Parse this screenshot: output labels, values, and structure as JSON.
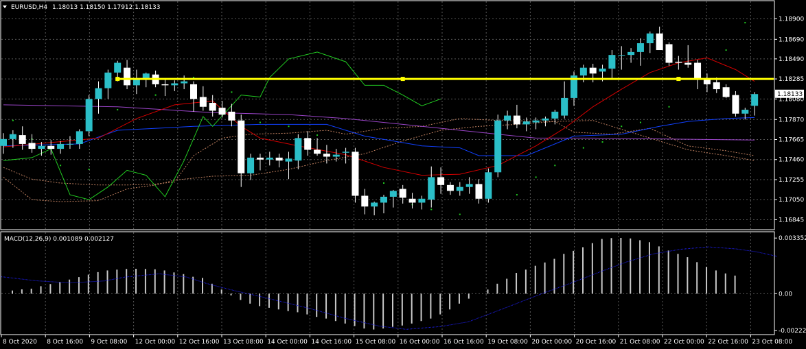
{
  "window": {
    "symbol_label": "EURUSD,H4",
    "ohlc_label": "1.18013 1.18150 1.17912 1.18133",
    "macd_label": "MACD(12,26,9) 0.001089 0.002127"
  },
  "colors": {
    "background": "#000000",
    "frame": "#ffffff",
    "grid": "#5a5a5a",
    "bull_candle": "#2bbfc8",
    "bear_candle": "#ffffff",
    "tenkan": "#d40000",
    "kijun": "#1040ff",
    "chikou": "#22cc22",
    "cloud_a": "#c08060",
    "cloud_b": "#c08060",
    "ma": "#9a44c8",
    "horizontal_line": "#ffff00",
    "price_tag_bg": "#ffffff",
    "price_tag_text": "#000000",
    "macd_hist": "#c8c8c8",
    "macd_signal": "#2020ff",
    "sar_dots": "#22cc22"
  },
  "chart_data": [
    {
      "type": "candlestick",
      "title": "EURUSD,H4",
      "price_axis": {
        "ylim": [
          1.1675,
          1.1905
        ],
        "ticks": [
          "1.18900",
          "1.18690",
          "1.18490",
          "1.18285",
          "1.18080",
          "1.17870",
          "1.17665",
          "1.17460",
          "1.17255",
          "1.17050",
          "1.16845"
        ],
        "current_price": "1.18133"
      },
      "time_axis": {
        "ticks": [
          "8 Oct 2020",
          "8 Oct 16:00",
          "9 Oct 08:00",
          "12 Oct 00:00",
          "12 Oct 16:00",
          "13 Oct 08:00",
          "14 Oct 00:00",
          "14 Oct 16:00",
          "15 Oct 08:00",
          "16 Oct 00:00",
          "16 Oct 16:00",
          "19 Oct 08:00",
          "20 Oct 00:00",
          "20 Oct 16:00",
          "21 Oct 08:00",
          "22 Oct 00:00",
          "22 Oct 16:00",
          "23 Oct 08:00"
        ]
      },
      "candles": [
        [
          1.176,
          1.1773,
          1.1752,
          1.1767
        ],
        [
          1.1767,
          1.1776,
          1.1758,
          1.1772
        ],
        [
          1.1771,
          1.178,
          1.1756,
          1.1762
        ],
        [
          1.1763,
          1.1772,
          1.1753,
          1.1757
        ],
        [
          1.1757,
          1.1764,
          1.175,
          1.176
        ],
        [
          1.176,
          1.1766,
          1.1751,
          1.1757
        ],
        [
          1.1757,
          1.1765,
          1.1752,
          1.1762
        ],
        [
          1.1762,
          1.177,
          1.1757,
          1.1762
        ],
        [
          1.1762,
          1.1777,
          1.1757,
          1.1775
        ],
        [
          1.1775,
          1.1812,
          1.177,
          1.1808
        ],
        [
          1.1808,
          1.1826,
          1.1793,
          1.1819
        ],
        [
          1.1819,
          1.1838,
          1.1808,
          1.1835
        ],
        [
          1.1835,
          1.1847,
          1.1826,
          1.1845
        ],
        [
          1.184,
          1.1848,
          1.1818,
          1.1822
        ],
        [
          1.1822,
          1.1838,
          1.1813,
          1.1828
        ],
        [
          1.1828,
          1.1835,
          1.182,
          1.1834
        ],
        [
          1.1833,
          1.1837,
          1.182,
          1.1823
        ],
        [
          1.1823,
          1.1828,
          1.1811,
          1.1822
        ],
        [
          1.1822,
          1.1827,
          1.1816,
          1.1824
        ],
        [
          1.1824,
          1.1832,
          1.1818,
          1.1826
        ],
        [
          1.1823,
          1.1826,
          1.1795,
          1.1808
        ],
        [
          1.181,
          1.1821,
          1.1796,
          1.18
        ],
        [
          1.1804,
          1.1812,
          1.179,
          1.1796
        ],
        [
          1.1799,
          1.1806,
          1.1789,
          1.1792
        ],
        [
          1.1795,
          1.1803,
          1.178,
          1.1786
        ],
        [
          1.1786,
          1.1792,
          1.1718,
          1.1732
        ],
        [
          1.1732,
          1.1752,
          1.1725,
          1.1748
        ],
        [
          1.1748,
          1.1752,
          1.1735,
          1.1746
        ],
        [
          1.1746,
          1.1754,
          1.174,
          1.1748
        ],
        [
          1.1748,
          1.1752,
          1.1738,
          1.1745
        ],
        [
          1.1744,
          1.1754,
          1.1726,
          1.1747
        ],
        [
          1.1745,
          1.1772,
          1.1736,
          1.1768
        ],
        [
          1.1768,
          1.1775,
          1.175,
          1.1756
        ],
        [
          1.1756,
          1.1768,
          1.175,
          1.1752
        ],
        [
          1.1752,
          1.1761,
          1.1742,
          1.1749
        ],
        [
          1.1749,
          1.1757,
          1.1744,
          1.1751
        ],
        [
          1.1753,
          1.1758,
          1.1742,
          1.1754
        ],
        [
          1.1754,
          1.1758,
          1.1702,
          1.1709
        ],
        [
          1.1709,
          1.1716,
          1.169,
          1.1698
        ],
        [
          1.1698,
          1.1703,
          1.1689,
          1.1702
        ],
        [
          1.1702,
          1.171,
          1.1691,
          1.1708
        ],
        [
          1.1708,
          1.1715,
          1.1697,
          1.1714
        ],
        [
          1.1716,
          1.172,
          1.1701,
          1.1707
        ],
        [
          1.1706,
          1.1712,
          1.1696,
          1.1702
        ],
        [
          1.1702,
          1.1709,
          1.1695,
          1.1706
        ],
        [
          1.1705,
          1.1739,
          1.1697,
          1.1728
        ],
        [
          1.1728,
          1.1738,
          1.1711,
          1.172
        ],
        [
          1.172,
          1.1723,
          1.171,
          1.1714
        ],
        [
          1.1714,
          1.1723,
          1.1709,
          1.1718
        ],
        [
          1.1718,
          1.1728,
          1.1711,
          1.1721
        ],
        [
          1.1721,
          1.1726,
          1.1701,
          1.1706
        ],
        [
          1.1706,
          1.1737,
          1.1702,
          1.1733
        ],
        [
          1.1733,
          1.1792,
          1.1728,
          1.1786
        ],
        [
          1.1786,
          1.1796,
          1.1777,
          1.1791
        ],
        [
          1.1791,
          1.1802,
          1.1778,
          1.1782
        ],
        [
          1.1782,
          1.1789,
          1.1775,
          1.1785
        ],
        [
          1.1784,
          1.1789,
          1.1777,
          1.1786
        ],
        [
          1.1786,
          1.179,
          1.178,
          1.1788
        ],
        [
          1.1788,
          1.1797,
          1.1782,
          1.1795
        ],
        [
          1.1791,
          1.1826,
          1.1788,
          1.1809
        ],
        [
          1.1809,
          1.1836,
          1.1801,
          1.1832
        ],
        [
          1.1832,
          1.1843,
          1.1825,
          1.184
        ],
        [
          1.184,
          1.1844,
          1.1825,
          1.1834
        ],
        [
          1.1836,
          1.1843,
          1.1826,
          1.1839
        ],
        [
          1.1839,
          1.1858,
          1.1828,
          1.1853
        ],
        [
          1.1853,
          1.1862,
          1.1838,
          1.1853
        ],
        [
          1.1853,
          1.186,
          1.1845,
          1.1856
        ],
        [
          1.1856,
          1.187,
          1.1842,
          1.1865
        ],
        [
          1.1865,
          1.1877,
          1.1855,
          1.1875
        ],
        [
          1.1875,
          1.1882,
          1.186,
          1.1858
        ],
        [
          1.1864,
          1.1866,
          1.1842,
          1.1845
        ],
        [
          1.1846,
          1.1852,
          1.1838,
          1.1845
        ],
        [
          1.1845,
          1.1863,
          1.184,
          1.1843
        ],
        [
          1.1845,
          1.1848,
          1.1818,
          1.1829
        ],
        [
          1.1829,
          1.1834,
          1.1815,
          1.1823
        ],
        [
          1.1825,
          1.183,
          1.1814,
          1.1818
        ],
        [
          1.182,
          1.1823,
          1.1809,
          1.181
        ],
        [
          1.1812,
          1.1816,
          1.179,
          1.1793
        ],
        [
          1.1793,
          1.1799,
          1.1787,
          1.1797
        ],
        [
          1.1801,
          1.1815,
          1.1791,
          1.1813
        ]
      ],
      "horizontal_line": 1.18285,
      "tenkan": [
        [
          0,
          1.1759
        ],
        [
          10,
          1.1768
        ],
        [
          14,
          1.1788
        ],
        [
          18,
          1.1802
        ],
        [
          22,
          1.1806
        ],
        [
          25,
          1.178
        ],
        [
          27,
          1.1768
        ],
        [
          31,
          1.176
        ],
        [
          36,
          1.1751
        ],
        [
          40,
          1.1738
        ],
        [
          44,
          1.173
        ],
        [
          48,
          1.1731
        ],
        [
          52,
          1.174
        ],
        [
          56,
          1.176
        ],
        [
          59,
          1.1778
        ],
        [
          62,
          1.18
        ],
        [
          65,
          1.1818
        ],
        [
          68,
          1.1835
        ],
        [
          71,
          1.1845
        ],
        [
          74,
          1.185
        ],
        [
          77,
          1.1838
        ],
        [
          79,
          1.1826
        ]
      ],
      "kijun": [
        [
          0,
          1.176
        ],
        [
          8,
          1.1762
        ],
        [
          12,
          1.1776
        ],
        [
          20,
          1.178
        ],
        [
          27,
          1.1782
        ],
        [
          34,
          1.1782
        ],
        [
          38,
          1.177
        ],
        [
          44,
          1.176
        ],
        [
          48,
          1.1758
        ],
        [
          50,
          1.175
        ],
        [
          55,
          1.175
        ],
        [
          60,
          1.177
        ],
        [
          65,
          1.1772
        ],
        [
          69,
          1.178
        ],
        [
          72,
          1.1785
        ],
        [
          76,
          1.1788
        ],
        [
          79,
          1.1789
        ]
      ],
      "chikou": [
        [
          0,
          1.1745
        ],
        [
          3,
          1.1748
        ],
        [
          5,
          1.1757
        ],
        [
          7,
          1.171
        ],
        [
          9,
          1.1705
        ],
        [
          11,
          1.1718
        ],
        [
          13,
          1.1735
        ],
        [
          15,
          1.173
        ],
        [
          17,
          1.1708
        ],
        [
          19,
          1.1745
        ],
        [
          21,
          1.179
        ],
        [
          22,
          1.178
        ],
        [
          25,
          1.1812
        ],
        [
          27,
          1.181
        ],
        [
          28,
          1.183
        ],
        [
          30,
          1.1849
        ],
        [
          33,
          1.1856
        ],
        [
          36,
          1.1846
        ],
        [
          38,
          1.1822
        ],
        [
          40,
          1.1822
        ],
        [
          42,
          1.1812
        ],
        [
          44,
          1.1801
        ],
        [
          46,
          1.1808
        ]
      ],
      "ma": [
        [
          0,
          1.1802
        ],
        [
          12,
          1.18
        ],
        [
          22,
          1.1794
        ],
        [
          30,
          1.1792
        ],
        [
          36,
          1.1788
        ],
        [
          42,
          1.1782
        ],
        [
          48,
          1.1776
        ],
        [
          52,
          1.1772
        ],
        [
          56,
          1.1768
        ],
        [
          62,
          1.1768
        ],
        [
          70,
          1.1767
        ],
        [
          79,
          1.1766
        ]
      ],
      "cloud_a": [
        [
          0,
          1.1738
        ],
        [
          3,
          1.1726
        ],
        [
          6,
          1.1722
        ],
        [
          10,
          1.172
        ],
        [
          13,
          1.172
        ],
        [
          16,
          1.1721
        ],
        [
          18,
          1.1723
        ],
        [
          20,
          1.175
        ],
        [
          23,
          1.1768
        ],
        [
          26,
          1.1772
        ],
        [
          30,
          1.1773
        ],
        [
          34,
          1.1776
        ],
        [
          36,
          1.1772
        ],
        [
          40,
          1.1778
        ],
        [
          44,
          1.178
        ],
        [
          48,
          1.1788
        ],
        [
          52,
          1.1786
        ],
        [
          58,
          1.1785
        ],
        [
          60,
          1.1774
        ],
        [
          64,
          1.1772
        ],
        [
          68,
          1.1778
        ],
        [
          72,
          1.176
        ],
        [
          76,
          1.1755
        ],
        [
          79,
          1.175
        ]
      ],
      "cloud_b": [
        [
          0,
          1.1728
        ],
        [
          3,
          1.1705
        ],
        [
          6,
          1.1703
        ],
        [
          10,
          1.1704
        ],
        [
          13,
          1.1716
        ],
        [
          16,
          1.172
        ],
        [
          18,
          1.1725
        ],
        [
          22,
          1.1729
        ],
        [
          26,
          1.173
        ],
        [
          30,
          1.1736
        ],
        [
          34,
          1.1745
        ],
        [
          38,
          1.1752
        ],
        [
          42,
          1.1765
        ],
        [
          46,
          1.1776
        ],
        [
          50,
          1.178
        ],
        [
          54,
          1.1782
        ],
        [
          58,
          1.1785
        ],
        [
          62,
          1.1786
        ],
        [
          64,
          1.178
        ],
        [
          68,
          1.1768
        ],
        [
          72,
          1.1756
        ],
        [
          76,
          1.175
        ],
        [
          79,
          1.1745
        ]
      ],
      "sar": [
        [
          1,
          1.1786
        ],
        [
          3,
          1.1767
        ],
        [
          6,
          1.174
        ],
        [
          9,
          1.1736
        ],
        [
          12,
          1.1797
        ],
        [
          16,
          1.1812
        ],
        [
          20,
          1.183
        ],
        [
          22,
          1.1803
        ],
        [
          24,
          1.1815
        ],
        [
          27,
          1.1784
        ],
        [
          30,
          1.178
        ],
        [
          33,
          1.1771
        ],
        [
          37,
          1.1736
        ],
        [
          40,
          1.1722
        ],
        [
          43,
          1.17
        ],
        [
          45,
          1.1695
        ],
        [
          48,
          1.169
        ],
        [
          51,
          1.1712
        ],
        [
          54,
          1.171
        ],
        [
          56,
          1.1728
        ],
        [
          58,
          1.174
        ],
        [
          61,
          1.1758
        ],
        [
          63,
          1.1764
        ],
        [
          65,
          1.178
        ],
        [
          67,
          1.1784
        ],
        [
          70,
          1.18
        ],
        [
          73,
          1.1835
        ],
        [
          76,
          1.1858
        ],
        [
          78,
          1.1886
        ]
      ]
    },
    {
      "type": "bar",
      "title": "MACD(12,26,9)",
      "ylim": [
        -0.00226,
        0.00336
      ],
      "ticks": [
        "0.003352",
        "0.00",
        "-0.002226"
      ],
      "histogram": [
        0.00019,
        0.00026,
        0.0003,
        0.00045,
        0.00058,
        0.0007,
        0.00085,
        0.001,
        0.00115,
        0.0013,
        0.0014,
        0.00145,
        0.00149,
        0.0015,
        0.00149,
        0.00147,
        0.0014,
        0.00128,
        0.00118,
        0.00102,
        0.00095,
        0.0006,
        0.00025,
        -0.0001,
        -0.00038,
        -0.0006,
        -0.00075,
        -0.00085,
        -0.00095,
        -0.00105,
        -0.00112,
        -0.00125,
        -0.0014,
        -0.0015,
        -0.00165,
        -0.0018,
        -0.00195,
        -0.0021,
        -0.00216,
        -0.0021,
        -0.002,
        -0.00192,
        -0.0018,
        -0.00165,
        -0.0015,
        -0.00125,
        -0.00095,
        -0.0006,
        -0.0003,
        0.0,
        0.00025,
        0.0006,
        0.0009,
        0.00125,
        0.00145,
        0.00168,
        0.00188,
        0.0021,
        0.0024,
        0.00258,
        0.0028,
        0.00305,
        0.0033,
        0.00335,
        0.00336,
        0.00333,
        0.00322,
        0.0031,
        0.00285,
        0.0026,
        0.0024,
        0.0022,
        0.0019,
        0.00162,
        0.0014,
        0.00122,
        0.00109
      ],
      "signal": [
        [
          0,
          0.00102
        ],
        [
          5,
          0.00078
        ],
        [
          10,
          0.00065
        ],
        [
          15,
          0.00077
        ],
        [
          18,
          0.001
        ],
        [
          23,
          0.0012
        ],
        [
          27,
          0.001
        ],
        [
          30,
          0.0006
        ],
        [
          34,
          0.00018
        ],
        [
          38,
          -0.0002
        ],
        [
          45,
          -0.0009
        ],
        [
          50,
          -0.00148
        ],
        [
          55,
          -0.00195
        ],
        [
          59,
          -0.00215
        ],
        [
          64,
          -0.00198
        ],
        [
          68,
          -0.0017
        ],
        [
          72,
          -0.00108
        ],
        [
          75,
          -0.0006
        ],
        [
          79,
          4e-05
        ],
        [
          83,
          0.00064
        ],
        [
          87,
          0.00128
        ],
        [
          91,
          0.0019
        ],
        [
          95,
          0.0024
        ],
        [
          99,
          0.00268
        ],
        [
          103,
          0.00282
        ],
        [
          107,
          0.0027
        ],
        [
          110,
          0.00252
        ],
        [
          113,
          0.00225
        ]
      ]
    }
  ]
}
